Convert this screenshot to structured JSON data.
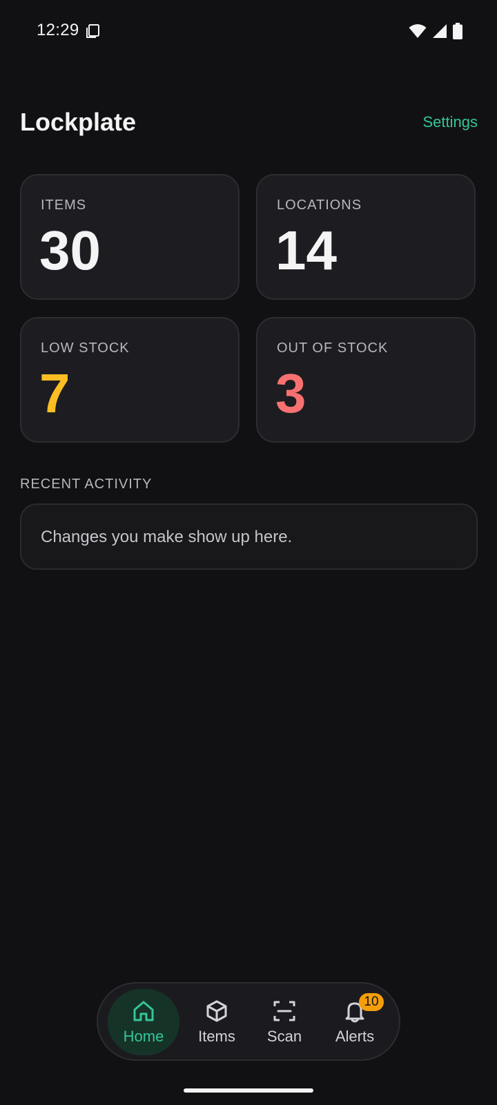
{
  "status_bar": {
    "time": "12:29"
  },
  "header": {
    "title": "Lockplate",
    "settings_label": "Settings"
  },
  "stats": [
    {
      "label": "ITEMS",
      "value": "30",
      "color": "#f4f4f5"
    },
    {
      "label": "LOCATIONS",
      "value": "14",
      "color": "#f4f4f5"
    },
    {
      "label": "LOW STOCK",
      "value": "7",
      "color": "#fbbf24"
    },
    {
      "label": "OUT OF STOCK",
      "value": "3",
      "color": "#f87171"
    }
  ],
  "recent_activity": {
    "title": "RECENT ACTIVITY",
    "empty_text": "Changes you make show up here."
  },
  "nav": {
    "items": [
      {
        "label": "Home",
        "icon": "home-icon",
        "active": true
      },
      {
        "label": "Items",
        "icon": "box-icon",
        "active": false
      },
      {
        "label": "Scan",
        "icon": "scan-icon",
        "active": false
      },
      {
        "label": "Alerts",
        "icon": "bell-icon",
        "active": false,
        "badge": "10"
      }
    ]
  },
  "colors": {
    "accent": "#34c69a",
    "background": "#111113",
    "card": "#1d1d21",
    "badge": "#f59e0b"
  }
}
